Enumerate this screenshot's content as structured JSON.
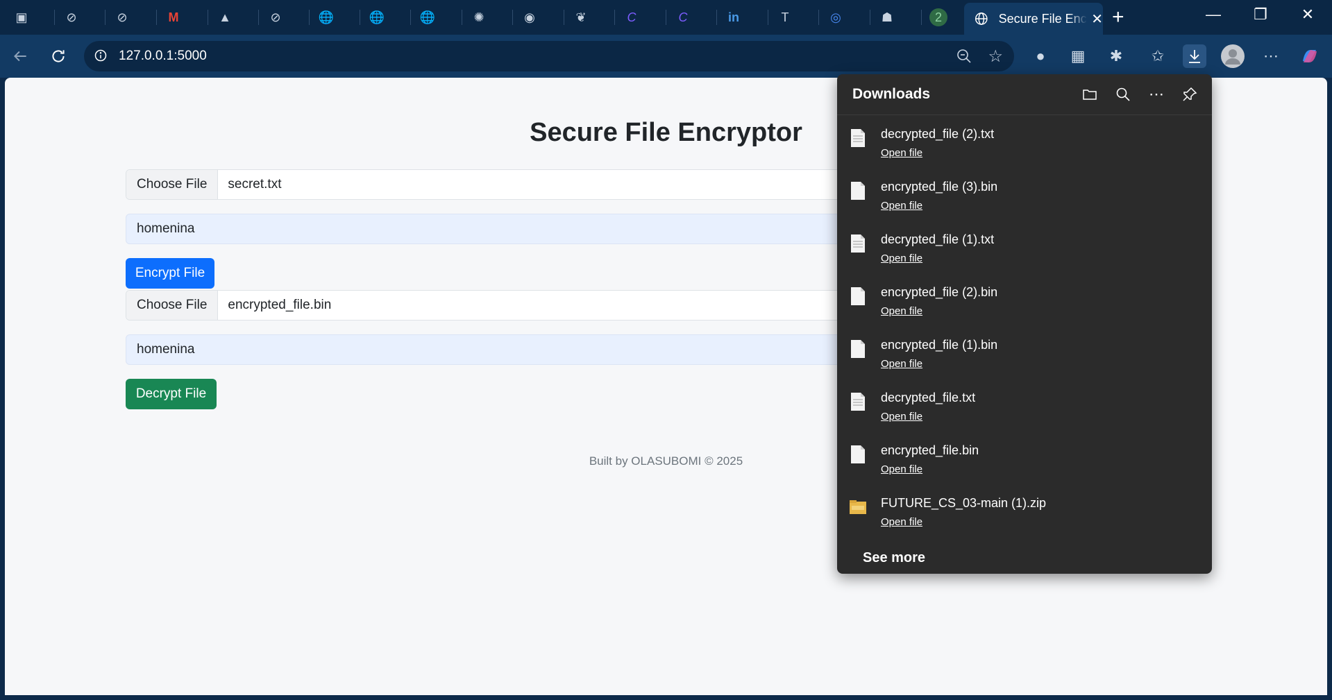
{
  "browser": {
    "active_tab": {
      "title": "Secure File Encryptor"
    },
    "address_bar": {
      "url": "127.0.0.1:5000"
    },
    "tab_icons": [
      "sidebar-icon",
      "ext-icon",
      "ext-icon",
      "gmail-icon",
      "dark-icon",
      "ext-icon",
      "globe-icon",
      "globe-icon",
      "globe-icon",
      "chatgpt-icon",
      "github-icon",
      "leaf-icon",
      "canva-icon",
      "canva-icon",
      "linkedin-icon",
      "app-icon",
      "circle-icon",
      "game-icon",
      "2-icon"
    ],
    "tab_glyphs": [
      "▣",
      "⊘",
      "⊘",
      "M",
      "▲",
      "⊘",
      "🌐",
      "🌐",
      "🌐",
      "✺",
      "◉",
      "❦",
      "C",
      "C",
      "in",
      "T",
      "◎",
      "☗",
      "2"
    ],
    "new_tab": "+",
    "close_tab": "✕",
    "window": {
      "minimize": "—",
      "restore": "❐",
      "close": "✕"
    }
  },
  "page": {
    "title": "Secure File Encryptor",
    "encrypt": {
      "choose_label": "Choose File",
      "file_name": "secret.txt",
      "password": "homenina",
      "button": "Encrypt File"
    },
    "decrypt": {
      "choose_label": "Choose File",
      "file_name": "encrypted_file.bin",
      "password": "homenina",
      "button": "Decrypt File"
    },
    "footer": "Built by OLASUBOMI © 2025"
  },
  "downloads": {
    "title": "Downloads",
    "items": [
      {
        "name": "decrypted_file (2).txt",
        "action": "Open file",
        "type": "text"
      },
      {
        "name": "encrypted_file (3).bin",
        "action": "Open file",
        "type": "blank"
      },
      {
        "name": "decrypted_file (1).txt",
        "action": "Open file",
        "type": "text"
      },
      {
        "name": "encrypted_file (2).bin",
        "action": "Open file",
        "type": "blank"
      },
      {
        "name": "encrypted_file (1).bin",
        "action": "Open file",
        "type": "blank"
      },
      {
        "name": "decrypted_file.txt",
        "action": "Open file",
        "type": "text"
      },
      {
        "name": "encrypted_file.bin",
        "action": "Open file",
        "type": "blank"
      },
      {
        "name": "FUTURE_CS_03-main (1).zip",
        "action": "Open file",
        "type": "zip"
      }
    ],
    "see_more": "See more"
  },
  "colors": {
    "primary": "#0d6efd",
    "success": "#198754",
    "browser_dark": "#0b2745",
    "toolbar": "#123a63"
  }
}
